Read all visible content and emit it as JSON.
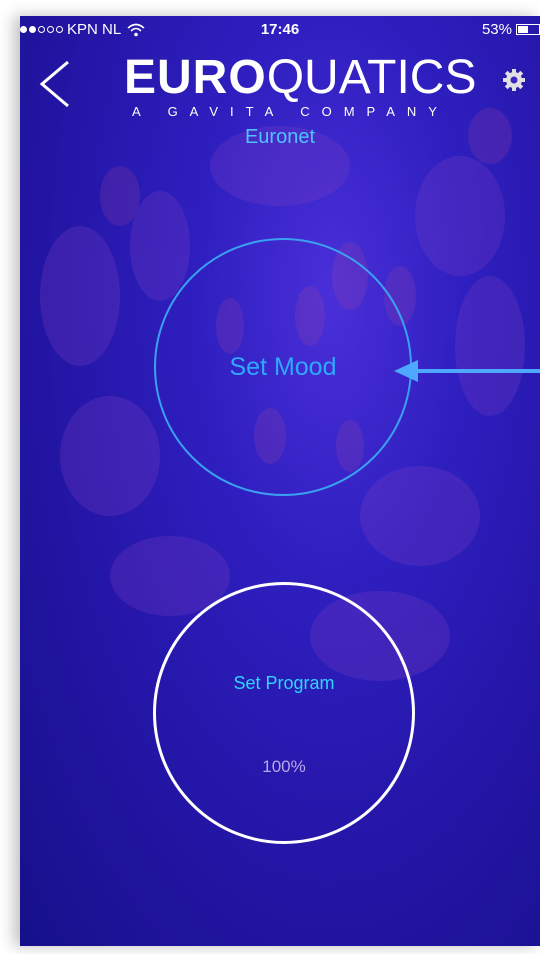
{
  "status_bar": {
    "carrier": "KPN NL",
    "time": "17:46",
    "battery": "53%",
    "battery_level": 0.53
  },
  "header": {
    "logo_bold": "EURO",
    "logo_thin": "QUATICS",
    "logo_sub": "A GAVITA COMPANY",
    "device_name": "Euronet"
  },
  "mood": {
    "label": "Set Mood"
  },
  "program": {
    "label": "Set Program",
    "percent": "100%"
  },
  "colors": {
    "accent_blue": "#2fa8ff",
    "program_label": "#2fd4ff",
    "background": "#2516a8"
  },
  "icons": {
    "back": "chevron-left-icon",
    "settings": "gear-icon",
    "wifi": "wifi-icon",
    "battery": "battery-icon",
    "arrow": "arrow-left-icon"
  }
}
